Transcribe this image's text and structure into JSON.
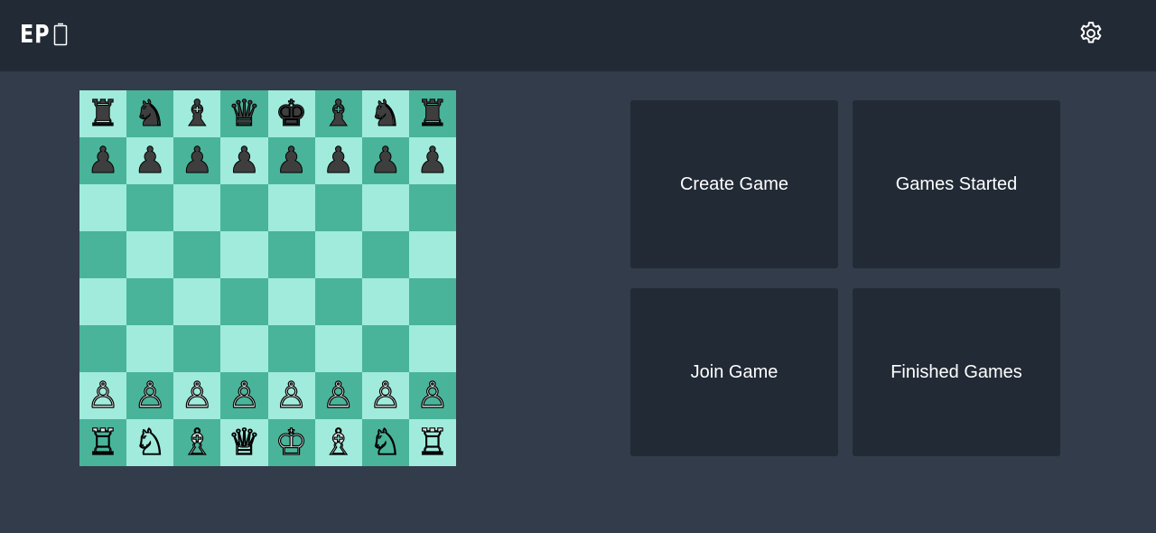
{
  "header": {
    "logo_text": "EP",
    "logo_icon": "phone-outline-icon",
    "settings_icon": "gear-icon"
  },
  "board": {
    "ranks": [
      [
        "♜",
        "♞",
        "♝",
        "♛",
        "♚",
        "♝",
        "♞",
        "♜"
      ],
      [
        "♟",
        "♟",
        "♟",
        "♟",
        "♟",
        "♟",
        "♟",
        "♟"
      ],
      [
        "",
        "",
        "",
        "",
        "",
        "",
        "",
        ""
      ],
      [
        "",
        "",
        "",
        "",
        "",
        "",
        "",
        ""
      ],
      [
        "",
        "",
        "",
        "",
        "",
        "",
        "",
        ""
      ],
      [
        "",
        "",
        "",
        "",
        "",
        "",
        "",
        ""
      ],
      [
        "♙",
        "♙",
        "♙",
        "♙",
        "♙",
        "♙",
        "♙",
        "♙"
      ],
      [
        "♖",
        "♘",
        "♗",
        "♕",
        "♔",
        "♗",
        "♘",
        "♖"
      ]
    ],
    "colors": {
      "light": "#a0ebdc",
      "dark": "#49b49a"
    }
  },
  "menu": {
    "create_game": "Create Game",
    "games_started": "Games Started",
    "join_game": "Join Game",
    "finished_games": "Finished Games"
  },
  "theme": {
    "background": "#323c4a",
    "panel": "#212a35",
    "text": "#ffffff"
  }
}
